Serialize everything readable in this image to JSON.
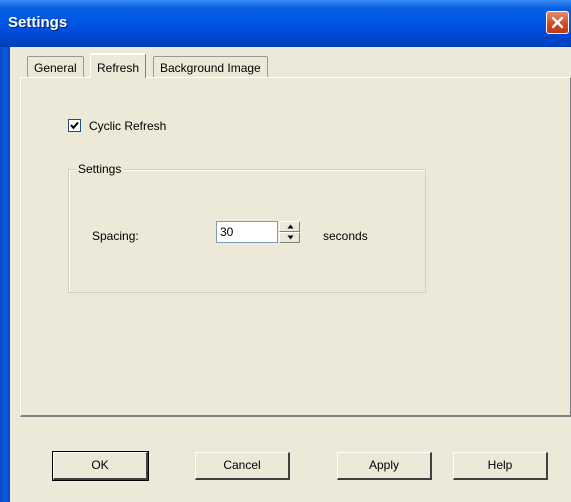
{
  "window": {
    "title": "Settings"
  },
  "tabs": [
    {
      "label": "General",
      "active": false
    },
    {
      "label": "Refresh",
      "active": true
    },
    {
      "label": "Background Image",
      "active": false
    }
  ],
  "refresh": {
    "cyclic_refresh": {
      "label": "Cyclic Refresh",
      "checked": true
    },
    "group": {
      "title": "Settings",
      "spacing_label": "Spacing:",
      "spacing_value": "30",
      "unit_label": "seconds"
    }
  },
  "buttons": {
    "ok": "OK",
    "cancel": "Cancel",
    "apply": "Apply",
    "help": "Help"
  },
  "icons": {
    "close": "close-icon",
    "check": "check-icon",
    "spin_up": "arrow-up-icon",
    "spin_down": "arrow-down-icon"
  }
}
